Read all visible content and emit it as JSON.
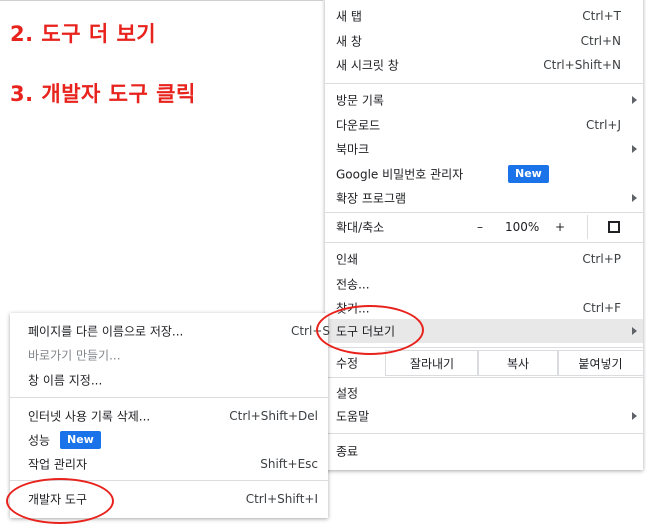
{
  "steps": {
    "step2": "2. 도구 더 보기",
    "step3": "3. 개발자 도구 클릭"
  },
  "main_menu": {
    "new_tab": {
      "label": "새 탭",
      "shortcut": "Ctrl+T"
    },
    "new_window": {
      "label": "새 창",
      "shortcut": "Ctrl+N"
    },
    "new_incognito": {
      "label": "새 시크릿 창",
      "shortcut": "Ctrl+Shift+N"
    },
    "history": {
      "label": "방문 기록"
    },
    "downloads": {
      "label": "다운로드",
      "shortcut": "Ctrl+J"
    },
    "bookmarks": {
      "label": "북마크"
    },
    "password_manager": {
      "label": "Google 비밀번호 관리자",
      "badge": "New"
    },
    "extensions": {
      "label": "확장 프로그램"
    },
    "zoom": {
      "label": "확대/축소",
      "minus": "–",
      "value": "100%",
      "plus": "+"
    },
    "print": {
      "label": "인쇄",
      "shortcut": "Ctrl+P"
    },
    "cast": {
      "label": "전송..."
    },
    "find": {
      "label": "찾기...",
      "shortcut": "Ctrl+F"
    },
    "more_tools": {
      "label": "도구 더보기"
    },
    "edit": {
      "label": "수정",
      "cut": "잘라내기",
      "copy": "복사",
      "paste": "붙여넣기"
    },
    "settings": {
      "label": "설정"
    },
    "help": {
      "label": "도움말"
    },
    "exit": {
      "label": "종료"
    }
  },
  "sub_menu": {
    "save_as": {
      "label": "페이지를 다른 이름으로 저장...",
      "shortcut": "Ctrl+S"
    },
    "create_shortcut": {
      "label": "바로가기 만들기..."
    },
    "name_window": {
      "label": "창 이름 지정..."
    },
    "clear_data": {
      "label": "인터넷 사용 기록 삭제...",
      "shortcut": "Ctrl+Shift+Del"
    },
    "performance": {
      "label": "성능",
      "badge": "New"
    },
    "task_manager": {
      "label": "작업 관리자",
      "shortcut": "Shift+Esc"
    },
    "dev_tools": {
      "label": "개발자 도구",
      "shortcut": "Ctrl+Shift+I"
    }
  },
  "colors": {
    "annotation": "#e8221c",
    "badge": "#1a73e8",
    "highlight": "#e8e8e8"
  }
}
